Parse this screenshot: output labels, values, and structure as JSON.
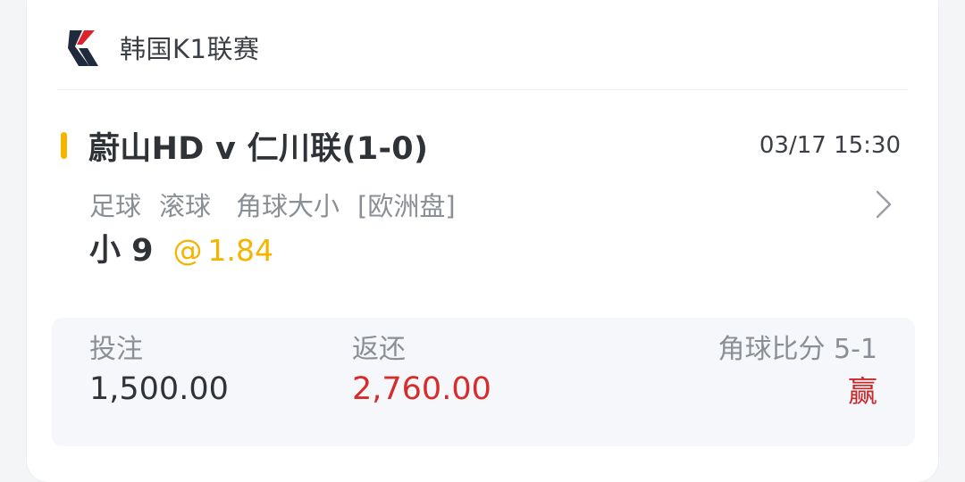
{
  "league": {
    "name": "韩国K1联赛",
    "logo_icon": "league-logo-icon"
  },
  "match": {
    "title": "蔚山HD v 仁川联(1-0)",
    "time": "03/17 15:30",
    "meta": {
      "sport": "足球",
      "mode": "滚球",
      "market": "角球大小",
      "odds_type": "[欧洲盘]"
    },
    "selection": "小 9",
    "odds_prefix": "@",
    "odds": "1.84",
    "detail_icon": "chevron-right-icon"
  },
  "summary": {
    "stake_label": "投注",
    "stake_value": "1,500.00",
    "return_label": "返还",
    "return_value": "2,760.00",
    "result_label": "角球比分 5-1",
    "result_status": "赢"
  },
  "colors": {
    "accent": "#f5b400",
    "win_red": "#d62c2c",
    "text_dark": "#2f3338",
    "text_muted": "#8a8f96"
  }
}
